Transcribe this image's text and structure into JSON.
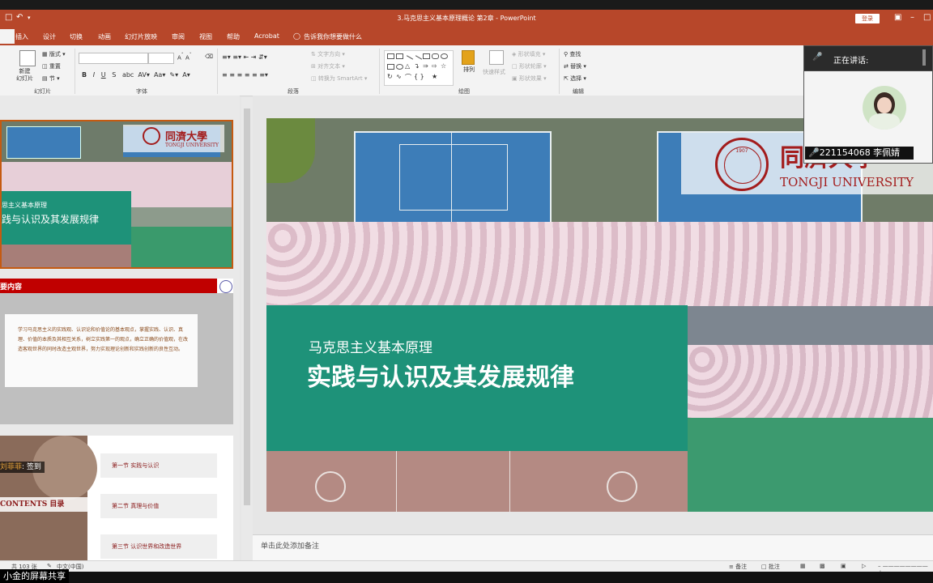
{
  "window": {
    "title": "3.马克思主义基本原理概论 第2章  -  PowerPoint",
    "sign_in": "登录"
  },
  "tabs": [
    "插入",
    "设计",
    "切换",
    "动画",
    "幻灯片放映",
    "审阅",
    "视图",
    "帮助",
    "Acrobat"
  ],
  "tell_me": "告诉我你想要做什么",
  "ribbon": {
    "groups": [
      "幻灯片",
      "字体",
      "段落",
      "绘图",
      "编辑"
    ],
    "new_slide": "新建\n幻灯片",
    "layout": "版式",
    "reset": "重置",
    "section": "节",
    "text_direction": "文字方向",
    "align_text": "对齐文本",
    "smartart": "转换为 SmartArt",
    "arrange": "排列",
    "quick_styles": "快速样式",
    "shape_fill": "形状填充",
    "shape_outline": "形状轮廓",
    "shape_effects": "形状效果",
    "find": "查找",
    "replace": "替换",
    "select": "选择"
  },
  "thumbs": {
    "t1_line1": "思主义基本原理",
    "t1_line2": "践与认识及其发展规律",
    "t2_header": "要内容",
    "t2_body": "学习马克思主义的实践观、认识论和价值论的基本观点，掌握实践、认识、真理、价值的本质及其相互关系，树立实践第一的观点，确立正确的价值观，在改造客观世界的同时改造主观世界，努力实现理论创新和实践创新的良性互动。",
    "t3_contents": "CONTENTS  目录",
    "t3_sign": "签到",
    "t3_name": "刘菲菲",
    "t3_items": [
      "第一节 实践与认识",
      "第二节 真理与价值",
      "第三节 认识世界和改造世界"
    ]
  },
  "slide": {
    "subtitle": "马克思主义基本原理",
    "title": "实践与认识及其发展规律",
    "logo_en": "TONGJI UNIVERSITY",
    "logo_cn": "同濟大學",
    "logo_year": "1907",
    "colors": {
      "green": "#1e9279",
      "court": "#3d7db8",
      "red": "#c00000"
    }
  },
  "notes_placeholder": "单击此处添加备注",
  "status": {
    "slide_count": "共 103 张",
    "language": "中文(中国)",
    "notes": "备注",
    "comments": "批注"
  },
  "overlay": {
    "speaking": "正在讲话:",
    "user": "221154068 李佩婧"
  },
  "share_label": "小金的屏幕共享"
}
